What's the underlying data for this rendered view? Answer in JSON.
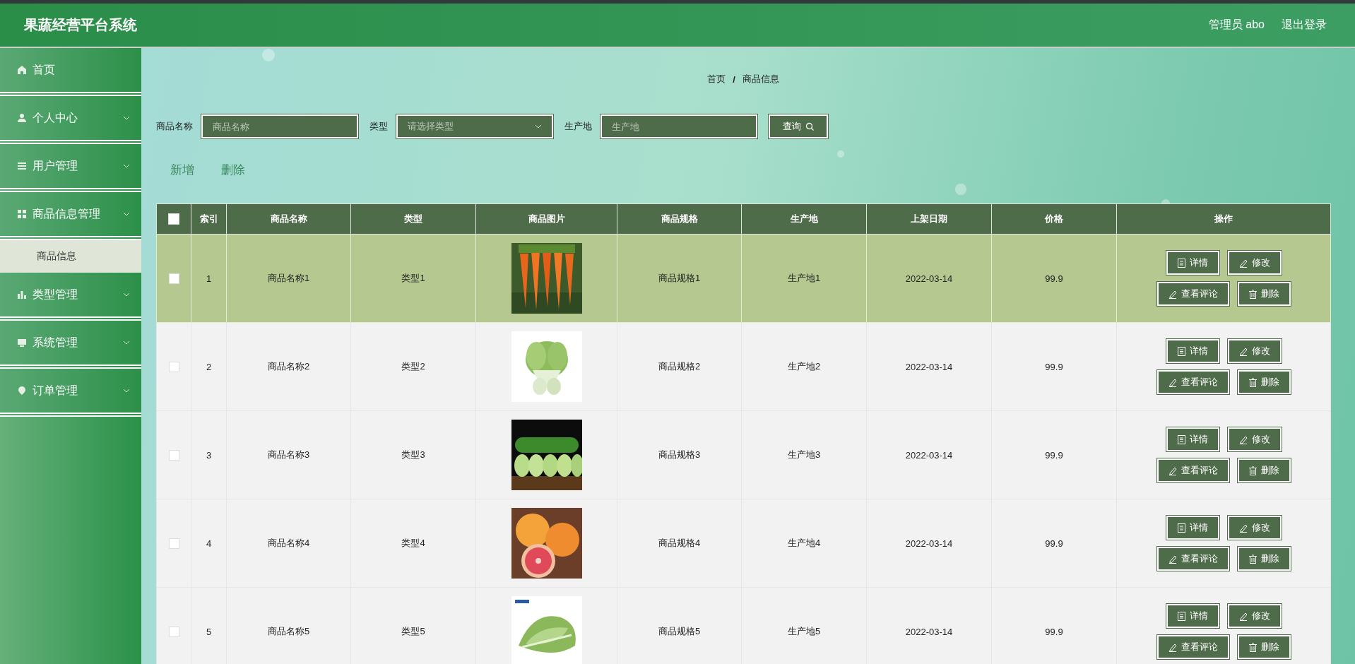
{
  "header": {
    "title": "果蔬经营平台系统",
    "user": "管理员 abo",
    "logout": "退出登录"
  },
  "sidebar": {
    "items": [
      {
        "label": "首页",
        "expandable": false
      },
      {
        "label": "个人中心",
        "expandable": true,
        "expanded": false
      },
      {
        "label": "用户管理",
        "expandable": true,
        "expanded": false
      },
      {
        "label": "商品信息管理",
        "expandable": true,
        "expanded": true,
        "children": [
          {
            "label": "商品信息",
            "selected": true
          }
        ]
      },
      {
        "label": "类型管理",
        "expandable": true,
        "expanded": false
      },
      {
        "label": "系统管理",
        "expandable": true,
        "expanded": false
      },
      {
        "label": "订单管理",
        "expandable": true,
        "expanded": false
      }
    ]
  },
  "breadcrumb": [
    "首页",
    "/",
    "商品信息"
  ],
  "search": {
    "fields": [
      {
        "kind": "input",
        "label": "商品名称",
        "placeholder": "商品名称"
      },
      {
        "kind": "select",
        "label": "类型",
        "placeholder": "请选择类型"
      },
      {
        "kind": "input",
        "label": "生产地",
        "placeholder": "生产地"
      }
    ],
    "button": "查询"
  },
  "actions": [
    "新增",
    "删除"
  ],
  "table": {
    "columns": [
      "索引",
      "商品名称",
      "类型",
      "商品图片",
      "商品规格",
      "生产地",
      "上架日期",
      "价格",
      "操作"
    ],
    "all_checked": false,
    "rows": [
      {
        "index": "1",
        "name": "商品名称1",
        "type": "类型1",
        "spec": "商品规格1",
        "origin": "生产地1",
        "date": "2022-03-14",
        "price": "99.9",
        "selected": true,
        "checked": false,
        "buttons": [
          "详情",
          "修改",
          "查看评论",
          "删除"
        ]
      },
      {
        "index": "2",
        "name": "商品名称2",
        "type": "类型2",
        "spec": "商品规格2",
        "origin": "生产地2",
        "date": "2022-03-14",
        "price": "99.9",
        "selected": false,
        "checked": false,
        "buttons": [
          "详情",
          "修改",
          "查看评论",
          "删除"
        ]
      },
      {
        "index": "3",
        "name": "商品名称3",
        "type": "类型3",
        "spec": "商品规格3",
        "origin": "生产地3",
        "date": "2022-03-14",
        "price": "99.9",
        "selected": false,
        "checked": false,
        "buttons": [
          "详情",
          "修改",
          "查看评论",
          "删除"
        ]
      },
      {
        "index": "4",
        "name": "商品名称4",
        "type": "类型4",
        "spec": "商品规格4",
        "origin": "生产地4",
        "date": "2022-03-14",
        "price": "99.9",
        "selected": false,
        "checked": false,
        "buttons": [
          "详情",
          "修改",
          "查看评论",
          "删除"
        ]
      },
      {
        "index": "5",
        "name": "商品名称5",
        "type": "类型5",
        "spec": "商品规格5",
        "origin": "生产地5",
        "date": "2022-03-14",
        "price": "99.9",
        "selected": false,
        "checked": false,
        "buttons": [
          "详情",
          "修改",
          "查看评论",
          "删除"
        ]
      }
    ]
  }
}
